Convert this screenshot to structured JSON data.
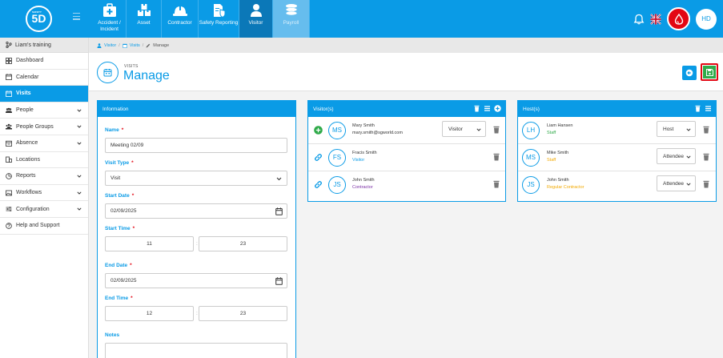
{
  "app": {
    "logo_small": "SAFETY",
    "logo_text": "5D",
    "user_initials": "HD",
    "colors": {
      "primary": "#0a9be6",
      "active_module": "#0b78b8",
      "save": "#2faa49",
      "danger": "#e30613"
    }
  },
  "modules": [
    {
      "label": "Accident / Incident",
      "icon": "first-aid-kit-icon"
    },
    {
      "label": "Asset",
      "icon": "boxes-icon"
    },
    {
      "label": "Contractor",
      "icon": "hard-hat-icon"
    },
    {
      "label": "Safety Reporting",
      "icon": "clipboard-shield-icon"
    },
    {
      "label": "Visitor",
      "icon": "person-icon"
    },
    {
      "label": "Payroll",
      "icon": "coins-icon"
    }
  ],
  "sidebar": {
    "org": "Liam's training",
    "items": [
      {
        "label": "Dashboard"
      },
      {
        "label": "Calendar"
      },
      {
        "label": "Visits"
      },
      {
        "label": "People"
      },
      {
        "label": "People Groups"
      },
      {
        "label": "Absence"
      },
      {
        "label": "Locations"
      },
      {
        "label": "Reports"
      },
      {
        "label": "Workflows"
      },
      {
        "label": "Configuration"
      },
      {
        "label": "Help and Support"
      }
    ]
  },
  "breadcrumb": {
    "item1": "Visitor",
    "item2": "Visits",
    "item3": "Manage",
    "sep": "/"
  },
  "page": {
    "kicker": "VISITS",
    "title": "Manage"
  },
  "info": {
    "title": "Information",
    "name_label": "Name",
    "name_value": "Meeting 02/09",
    "visit_type_label": "Visit Type",
    "visit_type_value": "Visit",
    "start_date_label": "Start Date",
    "start_date_value": "02/09/2025",
    "start_time_label": "Start Time",
    "start_hour": "11",
    "start_minute": "23",
    "end_date_label": "End Date",
    "end_date_value": "02/09/2025",
    "end_time_label": "End Time",
    "end_hour": "12",
    "end_minute": "23",
    "notes_label": "Notes",
    "required": "*",
    "colon": ":"
  },
  "visitors": {
    "title": "Visitor(s)",
    "rows": [
      {
        "initials": "MS",
        "name": "Mary Smith",
        "sub": "mary.smith@sgworld.com",
        "sub_color": "#333333",
        "role": "Visitor",
        "row_icon": "add-icon"
      },
      {
        "initials": "FS",
        "name": "Fracis Smith",
        "sub": "Visitor",
        "sub_color": "#0a9be6",
        "role": "",
        "row_icon": "link-icon"
      },
      {
        "initials": "JS",
        "name": "John Smith",
        "sub": "Contractor",
        "sub_color": "#7b2fa5",
        "role": "",
        "row_icon": "link-icon"
      }
    ]
  },
  "hosts": {
    "title": "Host(s)",
    "rows": [
      {
        "initials": "LH",
        "name": "Liam Hansen",
        "sub": "Staff",
        "sub_color": "#2faa49",
        "role": "Host"
      },
      {
        "initials": "MS",
        "name": "Mike Smith",
        "sub": "Staff",
        "sub_color": "#f2a900",
        "role": "Attendee"
      },
      {
        "initials": "JS",
        "name": "John Smith",
        "sub": "Regular Contractor",
        "sub_color": "#f2a900",
        "role": "Attendee"
      }
    ]
  }
}
